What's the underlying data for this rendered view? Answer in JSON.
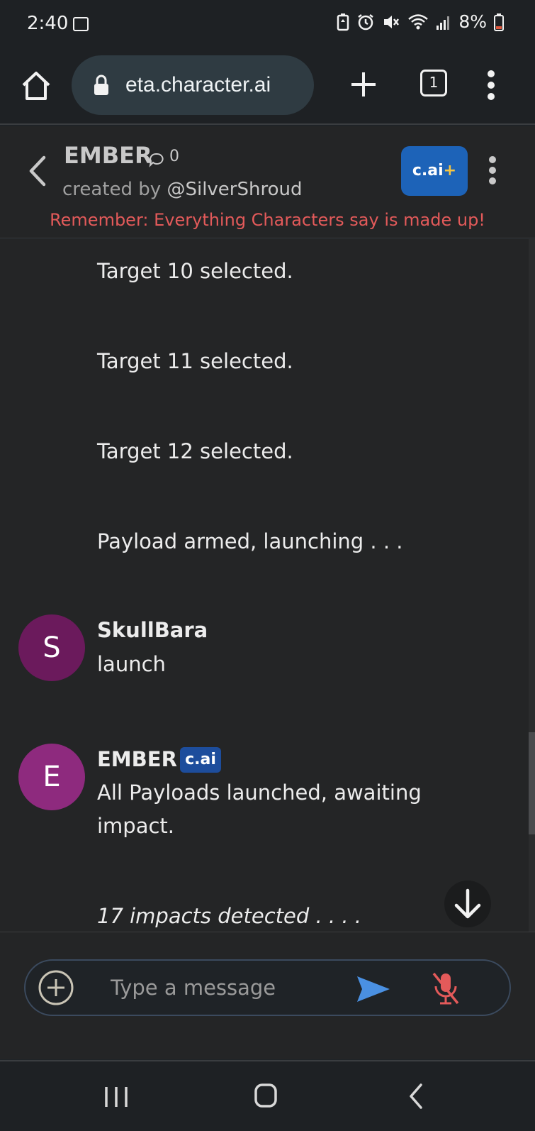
{
  "status_bar": {
    "time": "2:40",
    "battery": "8%",
    "icons": [
      "gallery-icon",
      "battery-saver-icon",
      "alarm-icon",
      "mute-icon",
      "wifi-icon",
      "signal-icon",
      "battery-icon"
    ]
  },
  "browser": {
    "url": "eta.character.ai",
    "tab_count": "1",
    "icons": [
      "home-icon",
      "lock-icon",
      "plus-icon",
      "tabs-icon",
      "more-vert-icon"
    ]
  },
  "header": {
    "character_name": "EMBER",
    "chat_count": "0",
    "created_by_prefix": "created by ",
    "creator_handle": "@SilverShroud",
    "upgrade_label_main": "c.ai",
    "upgrade_label_plus": "+",
    "disclaimer": "Remember: Everything Characters say is made up!",
    "accent_color": "#1d63b8",
    "disclaimer_color": "#e35a5a"
  },
  "messages": {
    "bot_lines_top": [
      "Target 10 selected.",
      "Target 11 selected.",
      "Target 12 selected.",
      "Payload armed, launching . . ."
    ],
    "user": {
      "avatar_letter": "S",
      "avatar_color": "#6b1a5c",
      "name": "SkullBara",
      "text": "launch"
    },
    "bot": {
      "avatar_letter": "E",
      "avatar_color": "#8e2a7e",
      "name": "EMBER",
      "badge": "c.ai",
      "text_line1": "All Payloads launched, awaiting",
      "text_line2": "impact.",
      "italic_line": "17 impacts detected . . . ."
    }
  },
  "composer": {
    "placeholder": "Type a message",
    "send_color": "#4a90e2",
    "mic_color": "#e35a5a"
  }
}
